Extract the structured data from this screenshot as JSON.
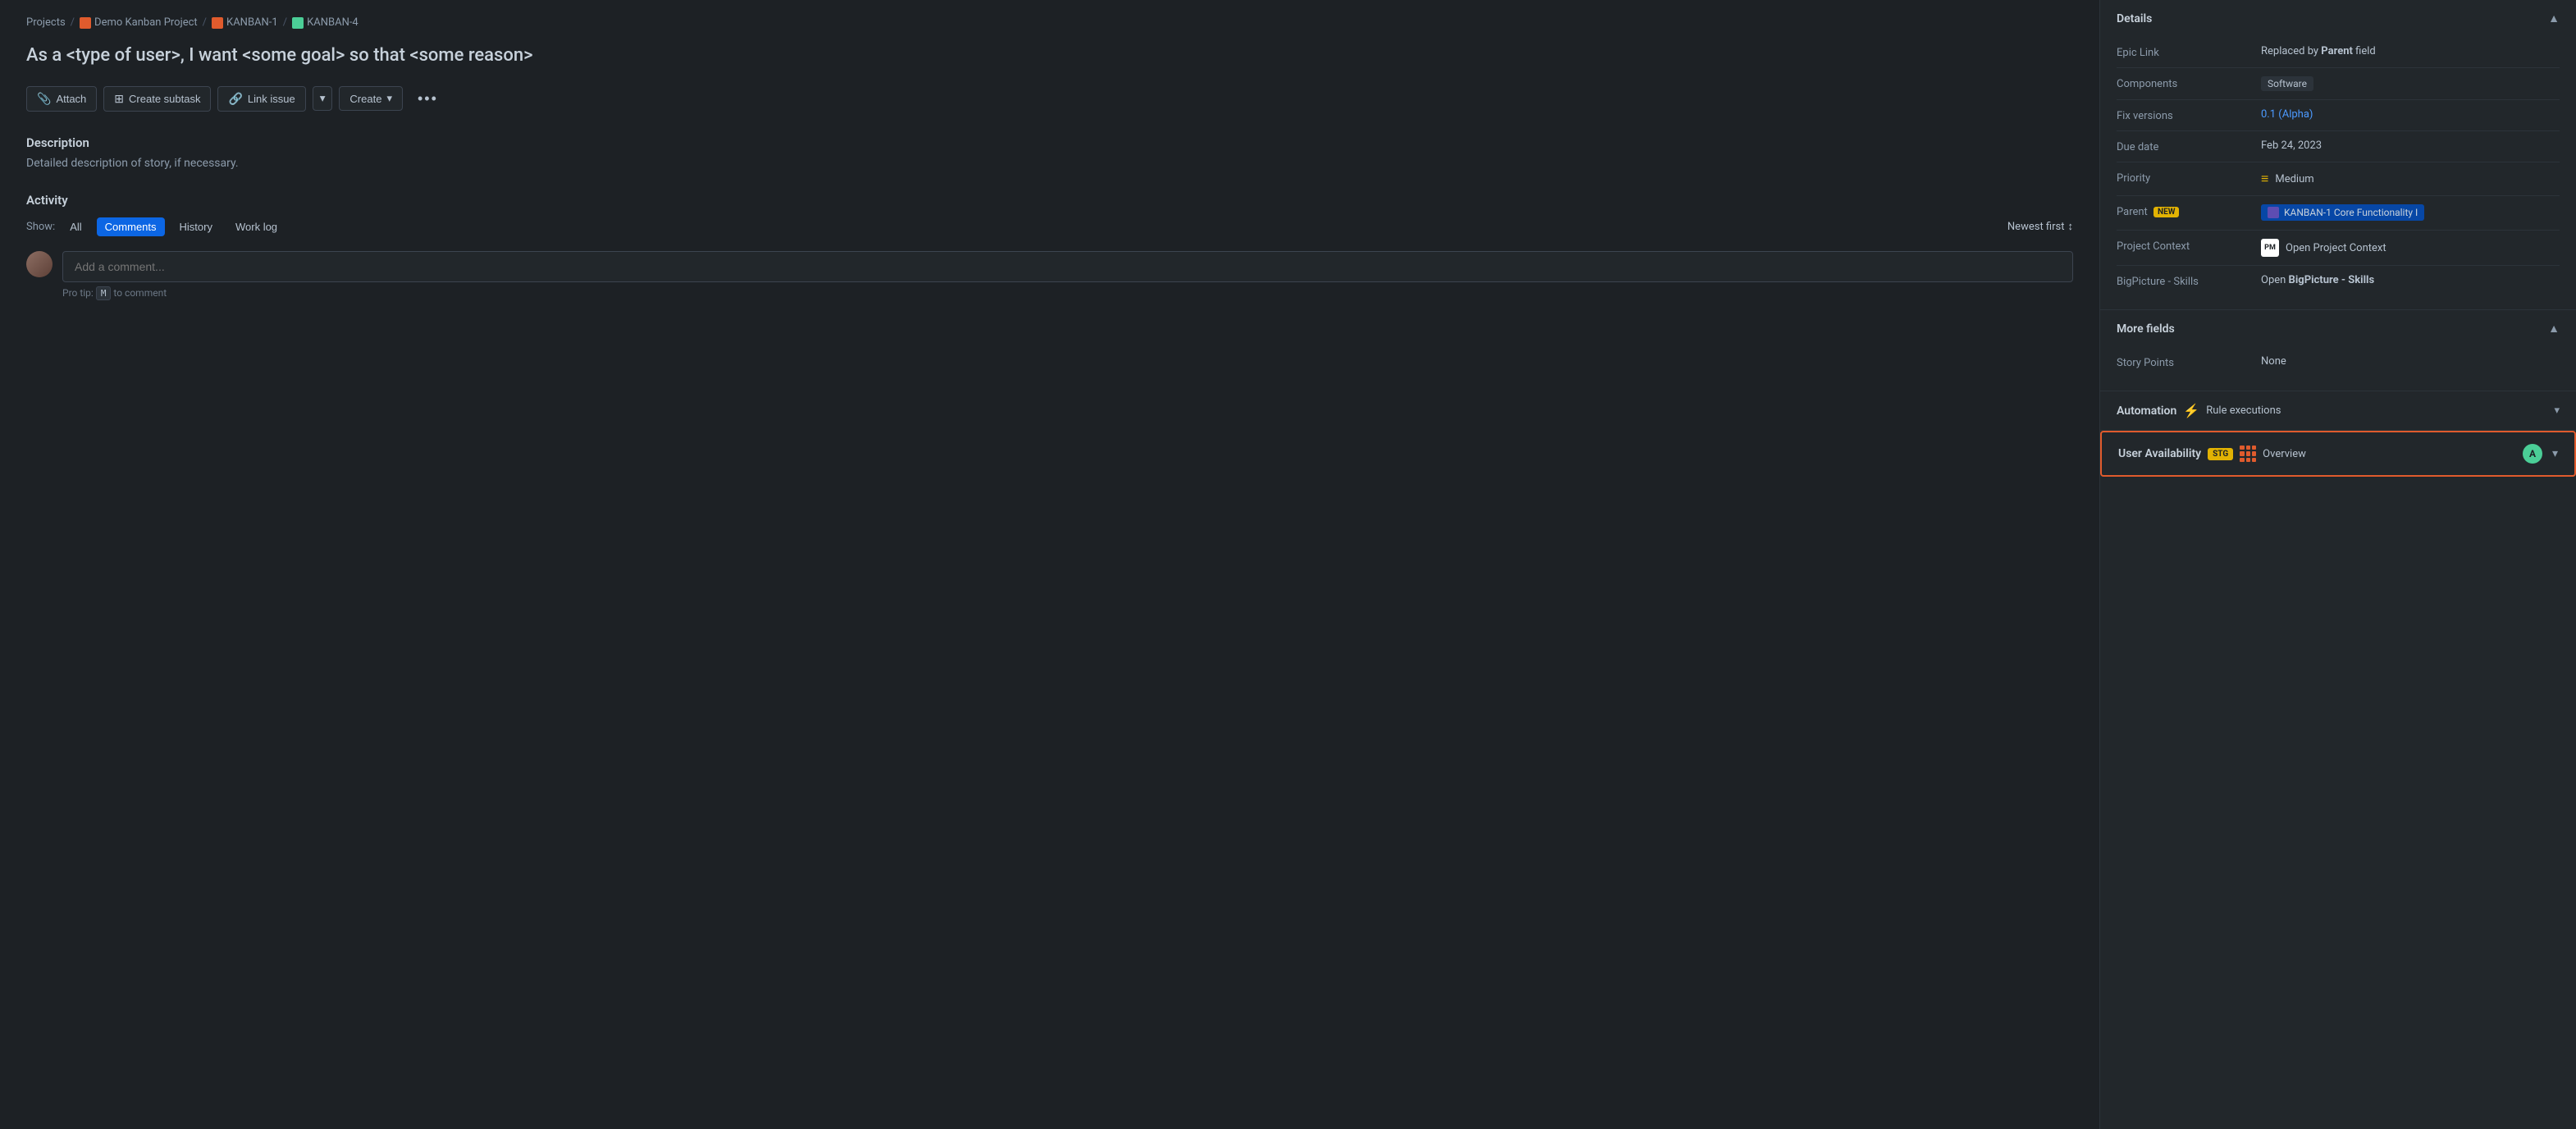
{
  "breadcrumb": {
    "projects": "Projects",
    "sep1": "/",
    "demo": "Demo Kanban Project",
    "sep2": "/",
    "kanban1": "KANBAN-1",
    "sep3": "/",
    "kanban4": "KANBAN-4"
  },
  "page": {
    "title": "As a <type of user>, I want <some goal> so that <some reason>"
  },
  "toolbar": {
    "attach": "Attach",
    "create_subtask": "Create subtask",
    "link_issue": "Link issue",
    "create": "Create"
  },
  "description": {
    "title": "Description",
    "text": "Detailed description of story, if necessary."
  },
  "activity": {
    "title": "Activity",
    "show_label": "Show:",
    "filters": [
      "All",
      "Comments",
      "History",
      "Work log"
    ],
    "active_filter": "Comments",
    "sort": "Newest first",
    "comment_placeholder": "Add a comment...",
    "pro_tip": "Pro tip:",
    "pro_tip_key": "M",
    "pro_tip_text": "to comment"
  },
  "details": {
    "section_title": "Details",
    "fields": [
      {
        "label": "Epic Link",
        "value": "Replaced by ",
        "bold": "Parent",
        "suffix": " field",
        "type": "text"
      },
      {
        "label": "Components",
        "value": "Software",
        "type": "badge"
      },
      {
        "label": "Fix versions",
        "value": "0.1 (Alpha)",
        "type": "link"
      },
      {
        "label": "Due date",
        "value": "Feb 24, 2023",
        "type": "text"
      },
      {
        "label": "Priority",
        "value": "Medium",
        "type": "priority"
      },
      {
        "label": "Parent",
        "badge_text": "NEW",
        "value": "KANBAN-1 Core Functionality I",
        "type": "parent"
      },
      {
        "label": "Project Context",
        "value": "Open Project Context",
        "type": "project_context"
      },
      {
        "label": "BigPicture - Skills",
        "value": "Open BigPicture - Skills",
        "bold_part": "BigPicture - Skills",
        "type": "bigpicture"
      }
    ]
  },
  "more_fields": {
    "section_title": "More fields",
    "fields": [
      {
        "label": "Story Points",
        "value": "None",
        "type": "text"
      }
    ]
  },
  "automation": {
    "title": "Automation",
    "rule_executions": "Rule executions"
  },
  "user_availability": {
    "title": "User Availability",
    "stg": "STG",
    "overview": "Overview",
    "a_badge": "A"
  }
}
